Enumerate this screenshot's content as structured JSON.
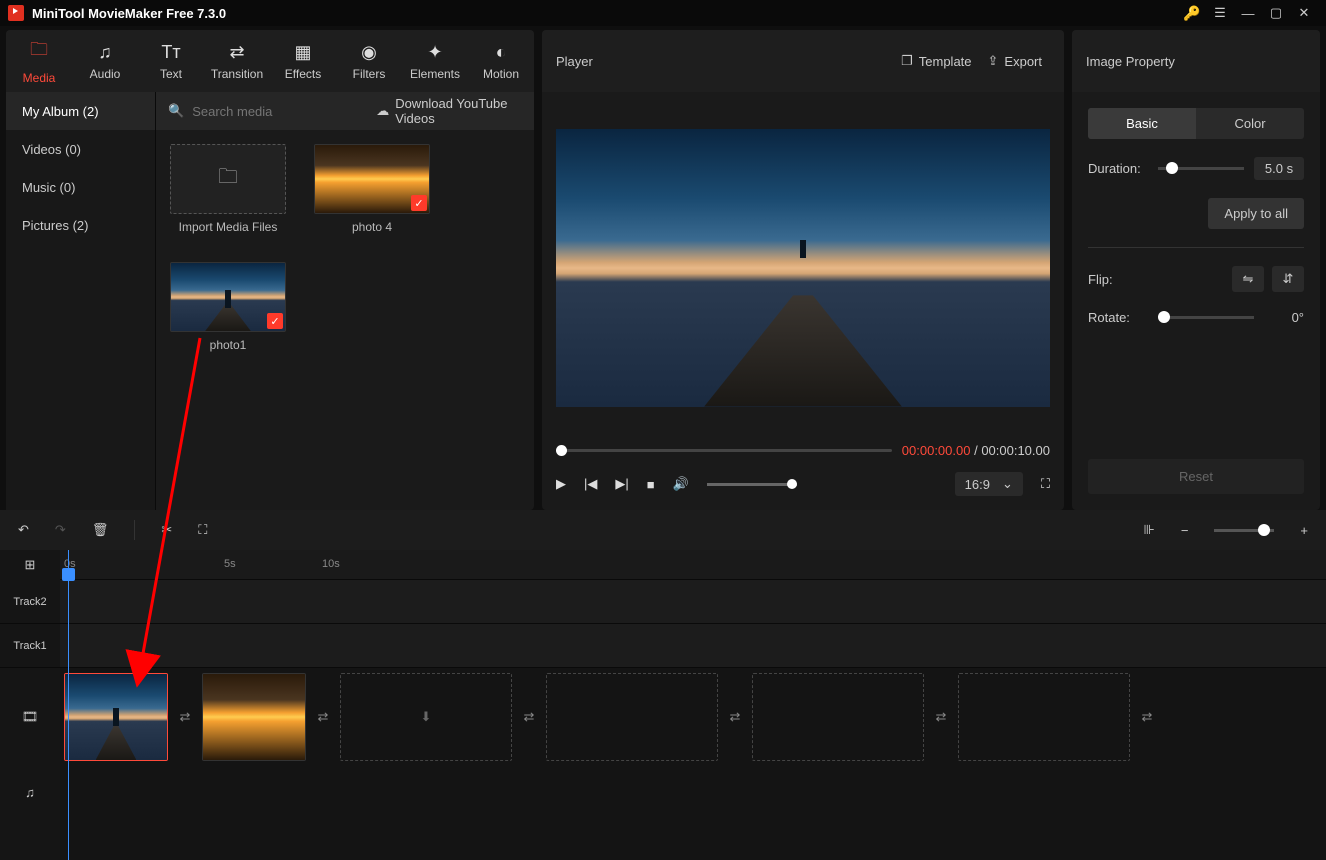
{
  "app": {
    "title": "MiniTool MovieMaker Free 7.3.0"
  },
  "tabs": {
    "media": "Media",
    "audio": "Audio",
    "text": "Text",
    "transition": "Transition",
    "effects": "Effects",
    "filters": "Filters",
    "elements": "Elements",
    "motion": "Motion"
  },
  "sidebar": {
    "my_album": "My Album (2)",
    "videos": "Videos (0)",
    "music": "Music (0)",
    "pictures": "Pictures (2)"
  },
  "media": {
    "search_placeholder": "Search media",
    "download_yt": "Download YouTube Videos",
    "import": "Import Media Files",
    "photo4": "photo 4",
    "photo1": "photo1"
  },
  "player": {
    "label": "Player",
    "template": "Template",
    "export": "Export",
    "cur": "00:00:00.00",
    "sep": " / ",
    "dur": "00:00:10.00",
    "aspect": "16:9"
  },
  "right": {
    "header": "Image Property",
    "basic": "Basic",
    "color": "Color",
    "duration": "Duration:",
    "duration_val": "5.0 s",
    "apply": "Apply to all",
    "flip": "Flip:",
    "rotate": "Rotate:",
    "rotate_val": "0°",
    "reset": "Reset"
  },
  "timeline": {
    "t0": "0s",
    "t5": "5s",
    "t10": "10s",
    "track2": "Track2",
    "track1": "Track1"
  }
}
